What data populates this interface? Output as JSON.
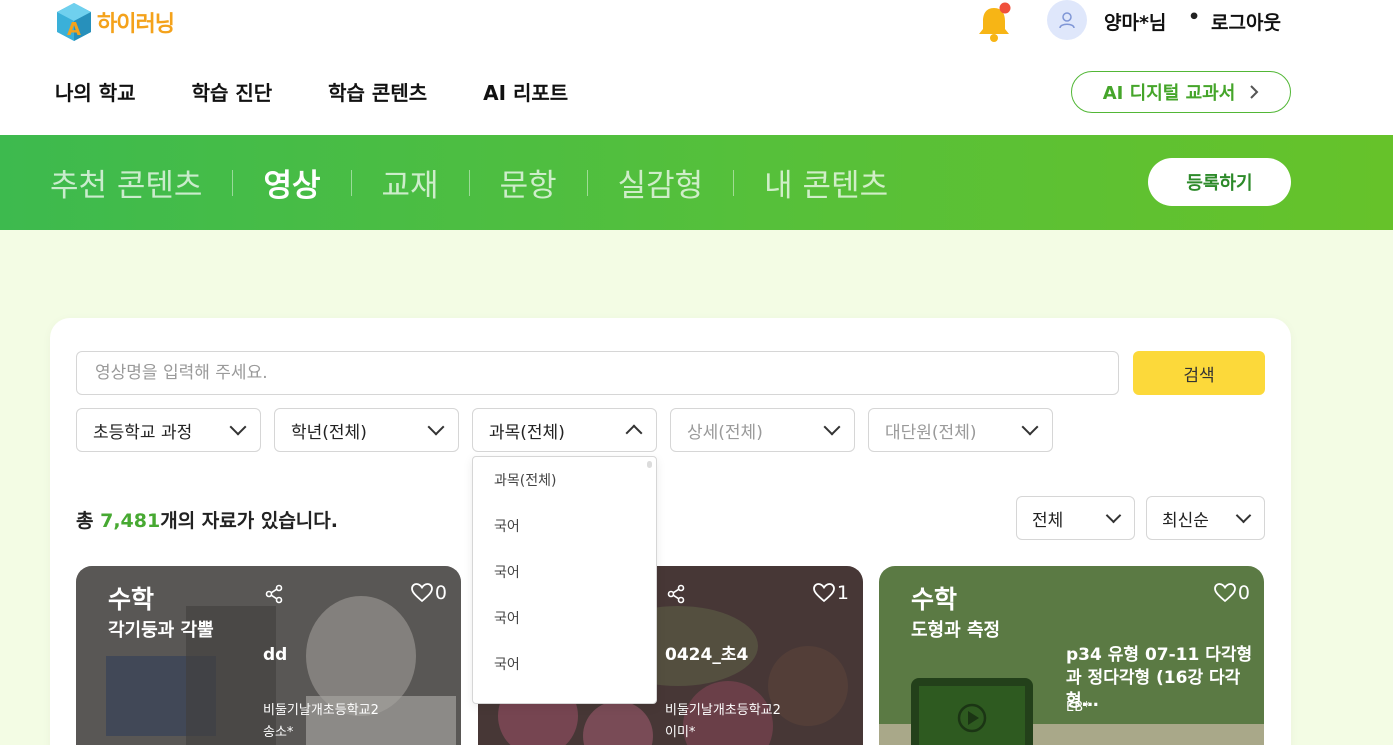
{
  "header": {
    "logo_text": "하이러닝",
    "user_name": "양마*님",
    "separator": "•",
    "logout_label": "로그아웃",
    "nav": [
      "나의 학교",
      "학습 진단",
      "학습 콘텐츠",
      "AI 리포트"
    ],
    "ai_button_label": "AI 디지털 교과서",
    "brand_color": "#f4a21b",
    "bell_badge_color": "#f0503c"
  },
  "banner": {
    "tabs": [
      {
        "label": "추천 콘텐츠",
        "active": false
      },
      {
        "label": "영상",
        "active": true
      },
      {
        "label": "교재",
        "active": false
      },
      {
        "label": "문항",
        "active": false
      },
      {
        "label": "실감형",
        "active": false
      },
      {
        "label": "내 콘텐츠",
        "active": false
      }
    ],
    "register_label": "등록하기",
    "accent_color": "#4dbd44"
  },
  "search": {
    "placeholder": "영상명을 입력해 주세요.",
    "button_label": "검색",
    "button_color": "#fcd93a"
  },
  "filters": {
    "curriculum": "초등학교 과정",
    "grade": "학년(전체)",
    "subject": "과목(전체)",
    "detail": "상세(전체)",
    "unit": "대단원(전체)"
  },
  "subject_dropdown": {
    "expanded": true,
    "options": [
      "과목(전체)",
      "국어",
      "국어",
      "국어",
      "국어"
    ]
  },
  "results": {
    "prefix": "총 ",
    "count": "7,481",
    "suffix": "개의 자료가 있습니다.",
    "scope_select": "전체",
    "order_select": "최신순"
  },
  "cards": [
    {
      "subject": "수학",
      "unit": "각기둥과 각뿔",
      "title": "dd",
      "school": "비둘기날개초등학교2",
      "author": "송소*",
      "likes": "0",
      "has_share": true
    },
    {
      "subject": "",
      "unit": "",
      "title": "0424_초4",
      "school": "비둘기날개초등학교2",
      "author": "이미*",
      "likes": "1",
      "has_share": true
    },
    {
      "subject": "수학",
      "unit": "도형과 측정",
      "title": "p34 유형 07-11 다각형과 정다각형 (16강 다각형…",
      "school": "",
      "author": "EB*",
      "likes": "0",
      "has_share": false
    }
  ]
}
